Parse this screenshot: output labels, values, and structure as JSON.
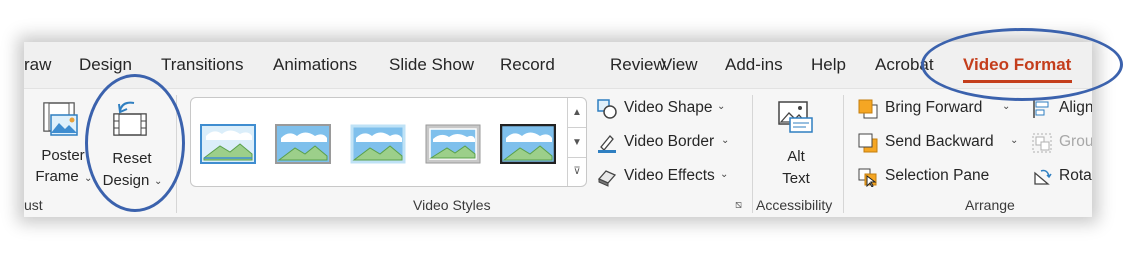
{
  "tabs": [
    {
      "label": "raw",
      "active": false
    },
    {
      "label": "Design",
      "active": false
    },
    {
      "label": "Transitions",
      "active": false
    },
    {
      "label": "Animations",
      "active": false
    },
    {
      "label": "Slide Show",
      "active": false
    },
    {
      "label": "Record",
      "active": false
    },
    {
      "label": "Review",
      "active": false
    },
    {
      "label": "View",
      "active": false
    },
    {
      "label": "Add-ins",
      "active": false
    },
    {
      "label": "Help",
      "active": false
    },
    {
      "label": "Acrobat",
      "active": false
    },
    {
      "label": "Video Format",
      "active": true
    }
  ],
  "adjust": {
    "poster_frame": {
      "line1": "Poster",
      "line2": "Frame"
    },
    "reset_design": {
      "line1": "Reset",
      "line2": "Design"
    },
    "group_label": "ust"
  },
  "video_styles": {
    "effects": {
      "shape": "Video Shape",
      "border": "Video Border",
      "effects": "Video Effects"
    },
    "group_label": "Video Styles"
  },
  "accessibility": {
    "alt_text": {
      "line1": "Alt",
      "line2": "Text"
    },
    "group_label": "Accessibility"
  },
  "arrange": {
    "bring_forward": "Bring Forward",
    "send_backward": "Send Backward",
    "selection_pane": "Selection Pane",
    "align": "Align",
    "group": "Grou",
    "rotate": "Rota",
    "group_label": "Arrange"
  },
  "colors": {
    "accent": "#c43e1c",
    "annotation": "#3b62ad"
  }
}
